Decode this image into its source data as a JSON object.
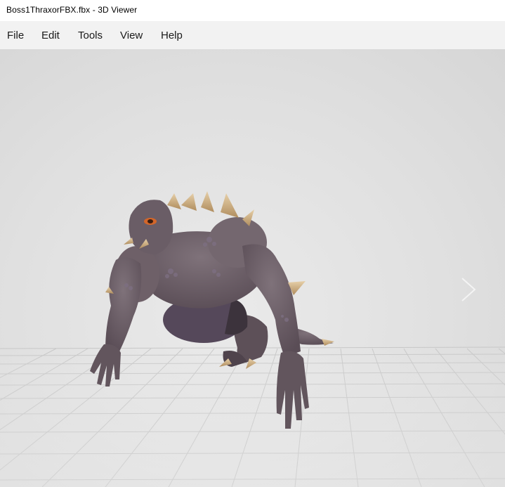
{
  "window": {
    "title": "Boss1ThraxorFBX.fbx - 3D Viewer"
  },
  "menu": {
    "items": [
      {
        "label": "File"
      },
      {
        "label": "Edit"
      },
      {
        "label": "Tools"
      },
      {
        "label": "View"
      },
      {
        "label": "Help"
      }
    ]
  },
  "viewport": {
    "model_name": "Boss1ThraxorFBX",
    "next_icon": "chevron-right-icon",
    "colors": {
      "background": "#e0e0e0",
      "grid_line": "#c4c4c4",
      "model_skin": "#6e6068",
      "model_shadow": "#4f434c",
      "spike": "#c9a87a",
      "eye": "#d2662a"
    }
  }
}
